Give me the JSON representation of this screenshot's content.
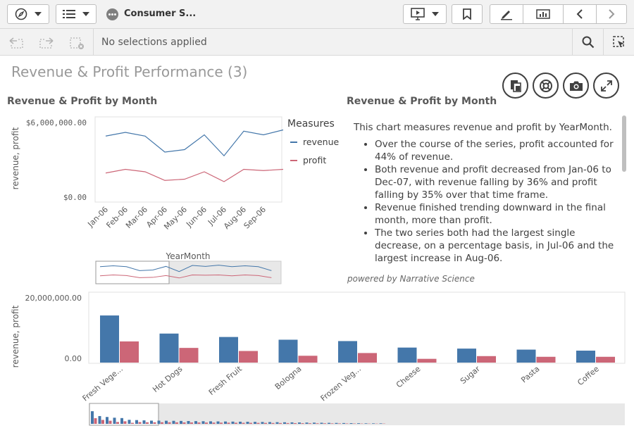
{
  "toolbar": {
    "app_title": "Consumer S...",
    "icons": [
      "compass-icon",
      "list-icon",
      "app-icon",
      "present-icon",
      "bookmark-icon",
      "edit-icon",
      "data-manager-icon",
      "chevron-left-icon",
      "chevron-right-icon"
    ]
  },
  "selections": {
    "status": "No selections applied"
  },
  "sheet": {
    "title": "Revenue & Profit Performance (3)"
  },
  "line_chart": {
    "title": "Revenue & Profit by Month",
    "ylabel": "revenue, profit",
    "xlabel": "YearMonth",
    "legend_title": "Measures"
  },
  "narrative": {
    "title": "Revenue & Profit by Month",
    "intro": "This chart measures revenue and profit by YearMonth.",
    "bullets": [
      "Over the course of the series, profit accounted for 44% of revenue.",
      "Both revenue and profit decreased from Jan-06 to Dec-07, with revenue falling by 36% and profit falling by 35% over that time frame.",
      "Revenue finished trending downward in the final month, more than profit.",
      "The two series both had the largest single decrease, on a percentage basis, in Jul-06 and the largest increase in Aug-06."
    ],
    "powered_by": "powered by Narrative Science"
  },
  "bar_chart": {
    "ylabel": "revenue, profit"
  },
  "colors": {
    "revenue": "#4477aa",
    "profit": "#cc6677"
  },
  "chart_data": [
    {
      "type": "line",
      "title": "Revenue & Profit by Month",
      "ylabel": "revenue, profit",
      "xlabel": "YearMonth",
      "x": [
        "Jan-06",
        "Feb-06",
        "Mar-06",
        "Apr-06",
        "May-06",
        "Jun-06",
        "Jul-06",
        "Aug-06",
        "Sep-06"
      ],
      "ylim": [
        0,
        6000000
      ],
      "ytick_labels": [
        "$6,000,000.00",
        "$0.00"
      ],
      "legend_title": "Measures",
      "legend_position": "right",
      "series": [
        {
          "name": "revenue",
          "values": [
            4900000,
            5200000,
            4900000,
            3600000,
            3800000,
            5000000,
            3300000,
            5300000,
            5000000,
            5400000
          ]
        },
        {
          "name": "profit",
          "values": [
            1900000,
            2200000,
            2000000,
            1300000,
            1400000,
            2000000,
            1200000,
            2200000,
            2100000,
            2200000
          ]
        }
      ]
    },
    {
      "type": "bar",
      "ylabel": "revenue, profit",
      "ylim": [
        0,
        20000000
      ],
      "ytick_labels": [
        "20,000,000.00",
        "0.00"
      ],
      "categories": [
        "Fresh Vege...",
        "Hot Dogs",
        "Fresh Fruit",
        "Bologna",
        "Frozen Veg...",
        "Cheese",
        "Sugar",
        "Pasta",
        "Coffee"
      ],
      "series": [
        {
          "name": "revenue",
          "values": [
            13800000,
            8500000,
            7500000,
            6700000,
            6300000,
            4400000,
            4100000,
            3800000,
            3500000
          ]
        },
        {
          "name": "profit",
          "values": [
            6200000,
            4300000,
            3400000,
            2000000,
            2800000,
            1100000,
            1900000,
            1700000,
            1700000
          ]
        }
      ]
    }
  ]
}
